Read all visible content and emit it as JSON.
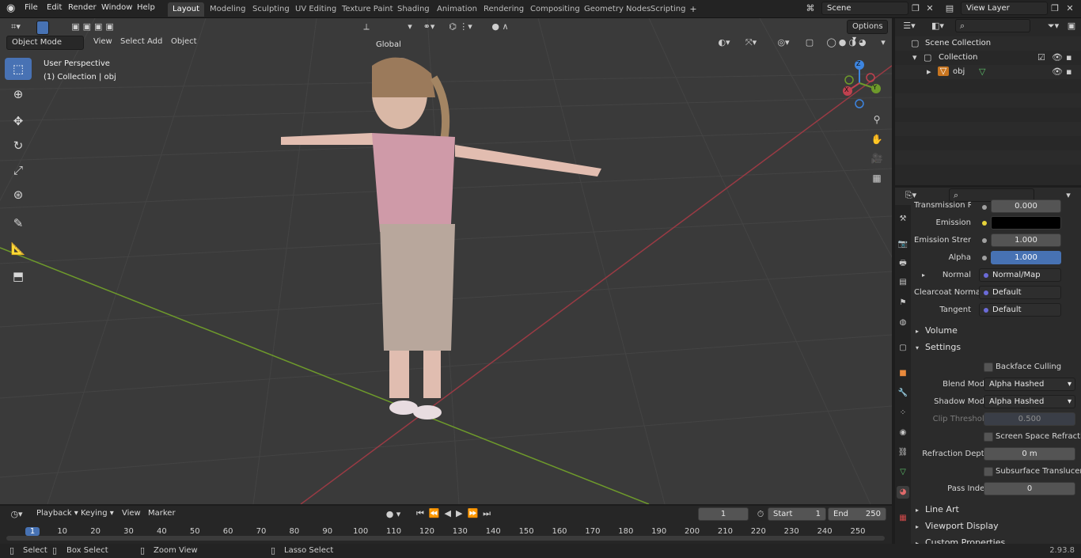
{
  "menu": [
    "File",
    "Edit",
    "Render",
    "Window",
    "Help"
  ],
  "workspaces": [
    "Layout",
    "Modeling",
    "Sculpting",
    "UV Editing",
    "Texture Paint",
    "Shading",
    "Animation",
    "Rendering",
    "Compositing",
    "Geometry Nodes",
    "Scripting"
  ],
  "scene_name": "Scene",
  "view_layer": "View Layer",
  "viewport": {
    "mode": "Object Mode",
    "menus": [
      "View",
      "Select",
      "Add",
      "Object"
    ],
    "orientation": "Global",
    "options": "Options",
    "perspective_label": "User Perspective",
    "collection_label": "(1) Collection | obj",
    "gizmo": {
      "z": "Z",
      "y": "Y",
      "x": "X"
    }
  },
  "outliner": {
    "scene_collection": "Scene Collection",
    "collection": "Collection",
    "object": "obj"
  },
  "properties": {
    "transmission": {
      "label": "Transmission R...",
      "value": "0.000"
    },
    "emission": {
      "label": "Emission"
    },
    "emission_strength": {
      "label": "Emission Strengt",
      "value": "1.000"
    },
    "alpha": {
      "label": "Alpha",
      "value": "1.000"
    },
    "normal": {
      "label": "Normal",
      "value": "Normal/Map"
    },
    "clearcoat_normal": {
      "label": "Clearcoat Normal",
      "value": "Default"
    },
    "tangent": {
      "label": "Tangent",
      "value": "Default"
    },
    "volume": "Volume",
    "settings": "Settings",
    "backface_culling": "Backface Culling",
    "blend_mode": {
      "label": "Blend Mode",
      "value": "Alpha Hashed"
    },
    "shadow_mode": {
      "label": "Shadow Mode",
      "value": "Alpha Hashed"
    },
    "clip_threshold": {
      "label": "Clip Threshold",
      "value": "0.500"
    },
    "screen_space_refraction": "Screen Space Refraction",
    "refraction_depth": {
      "label": "Refraction Depth",
      "value": "0 m"
    },
    "subsurface_translucency": "Subsurface Translucency",
    "pass_index": {
      "label": "Pass Index",
      "value": "0"
    },
    "line_art": "Line Art",
    "viewport_display": "Viewport Display",
    "custom_properties": "Custom Properties"
  },
  "timeline": {
    "menus": [
      "Playback",
      "Keying",
      "View",
      "Marker"
    ],
    "current_frame": "1",
    "start_label": "Start",
    "start": "1",
    "end_label": "End",
    "end": "250",
    "ticks": [
      "1",
      "10",
      "20",
      "30",
      "40",
      "50",
      "60",
      "70",
      "80",
      "90",
      "100",
      "110",
      "120",
      "130",
      "140",
      "150",
      "160",
      "170",
      "180",
      "190",
      "200",
      "210",
      "220",
      "230",
      "240",
      "250"
    ]
  },
  "status": {
    "select": "Select",
    "box_select": "Box Select",
    "zoom_view": "Zoom View",
    "lasso_select": "Lasso Select",
    "version": "2.93.8"
  },
  "colors": {
    "accent": "#4772b3",
    "x_axis": "#c0414f",
    "y_axis": "#6e9a2b",
    "z_axis": "#3d85e0"
  }
}
